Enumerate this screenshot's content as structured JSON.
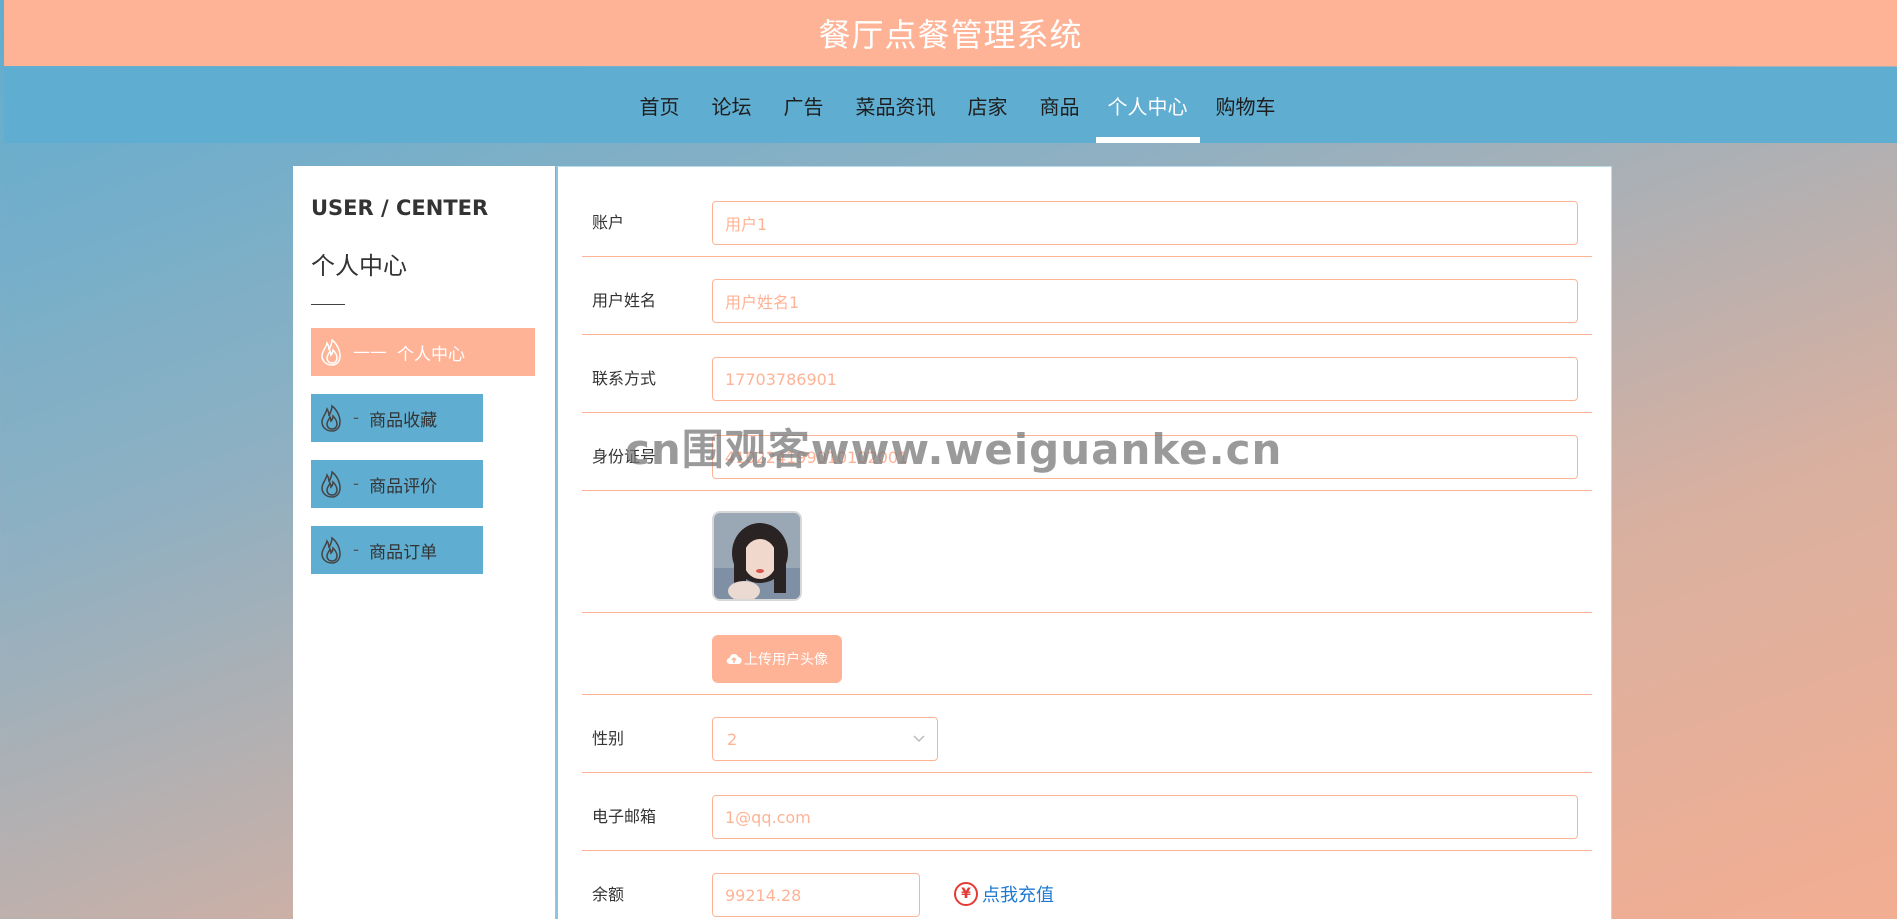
{
  "header": {
    "title": "餐厅点餐管理系统"
  },
  "nav": {
    "items": [
      {
        "label": "首页"
      },
      {
        "label": "论坛"
      },
      {
        "label": "广告"
      },
      {
        "label": "菜品资讯"
      },
      {
        "label": "店家"
      },
      {
        "label": "商品"
      },
      {
        "label": "个人中心",
        "active": true
      },
      {
        "label": "购物车"
      }
    ]
  },
  "sidebar": {
    "en_title": "USER / CENTER",
    "cn_title": "个人中心",
    "items": [
      {
        "label": "个人中心",
        "dash": "——",
        "active": true
      },
      {
        "label": "商品收藏",
        "dash": "-"
      },
      {
        "label": "商品评价",
        "dash": "-"
      },
      {
        "label": "商品订单",
        "dash": "-"
      }
    ]
  },
  "form": {
    "account": {
      "label": "账户",
      "value": "用户1"
    },
    "username": {
      "label": "用户姓名",
      "value": "用户姓名1"
    },
    "phone": {
      "label": "联系方式",
      "value": "17703786901"
    },
    "idcard": {
      "label": "身份证号",
      "value": "410224199010102001"
    },
    "upload_label": "上传用户头像",
    "gender": {
      "label": "性别",
      "value": "2"
    },
    "email": {
      "label": "电子邮箱",
      "value": "1@qq.com"
    },
    "balance": {
      "label": "余额",
      "value": "99214.28"
    },
    "recharge_label": "点我充值",
    "recharge_icon": "¥"
  },
  "watermark": "cn围观客www.weiguanke.cn",
  "colors": {
    "accent": "#ffb396",
    "nav": "#5fadd0",
    "link": "#1e79d4"
  }
}
